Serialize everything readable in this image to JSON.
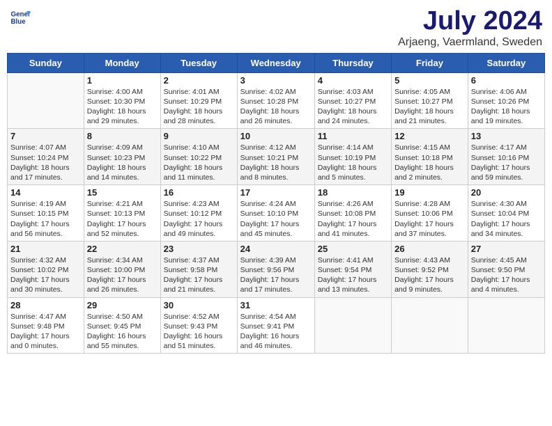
{
  "logo": {
    "line1": "General",
    "line2": "Blue"
  },
  "title": "July 2024",
  "location": "Arjaeng, Vaermland, Sweden",
  "weekdays": [
    "Sunday",
    "Monday",
    "Tuesday",
    "Wednesday",
    "Thursday",
    "Friday",
    "Saturday"
  ],
  "weeks": [
    [
      {
        "day": "",
        "info": ""
      },
      {
        "day": "1",
        "info": "Sunrise: 4:00 AM\nSunset: 10:30 PM\nDaylight: 18 hours\nand 29 minutes."
      },
      {
        "day": "2",
        "info": "Sunrise: 4:01 AM\nSunset: 10:29 PM\nDaylight: 18 hours\nand 28 minutes."
      },
      {
        "day": "3",
        "info": "Sunrise: 4:02 AM\nSunset: 10:28 PM\nDaylight: 18 hours\nand 26 minutes."
      },
      {
        "day": "4",
        "info": "Sunrise: 4:03 AM\nSunset: 10:27 PM\nDaylight: 18 hours\nand 24 minutes."
      },
      {
        "day": "5",
        "info": "Sunrise: 4:05 AM\nSunset: 10:27 PM\nDaylight: 18 hours\nand 21 minutes."
      },
      {
        "day": "6",
        "info": "Sunrise: 4:06 AM\nSunset: 10:26 PM\nDaylight: 18 hours\nand 19 minutes."
      }
    ],
    [
      {
        "day": "7",
        "info": "Sunrise: 4:07 AM\nSunset: 10:24 PM\nDaylight: 18 hours\nand 17 minutes."
      },
      {
        "day": "8",
        "info": "Sunrise: 4:09 AM\nSunset: 10:23 PM\nDaylight: 18 hours\nand 14 minutes."
      },
      {
        "day": "9",
        "info": "Sunrise: 4:10 AM\nSunset: 10:22 PM\nDaylight: 18 hours\nand 11 minutes."
      },
      {
        "day": "10",
        "info": "Sunrise: 4:12 AM\nSunset: 10:21 PM\nDaylight: 18 hours\nand 8 minutes."
      },
      {
        "day": "11",
        "info": "Sunrise: 4:14 AM\nSunset: 10:19 PM\nDaylight: 18 hours\nand 5 minutes."
      },
      {
        "day": "12",
        "info": "Sunrise: 4:15 AM\nSunset: 10:18 PM\nDaylight: 18 hours\nand 2 minutes."
      },
      {
        "day": "13",
        "info": "Sunrise: 4:17 AM\nSunset: 10:16 PM\nDaylight: 17 hours\nand 59 minutes."
      }
    ],
    [
      {
        "day": "14",
        "info": "Sunrise: 4:19 AM\nSunset: 10:15 PM\nDaylight: 17 hours\nand 56 minutes."
      },
      {
        "day": "15",
        "info": "Sunrise: 4:21 AM\nSunset: 10:13 PM\nDaylight: 17 hours\nand 52 minutes."
      },
      {
        "day": "16",
        "info": "Sunrise: 4:23 AM\nSunset: 10:12 PM\nDaylight: 17 hours\nand 49 minutes."
      },
      {
        "day": "17",
        "info": "Sunrise: 4:24 AM\nSunset: 10:10 PM\nDaylight: 17 hours\nand 45 minutes."
      },
      {
        "day": "18",
        "info": "Sunrise: 4:26 AM\nSunset: 10:08 PM\nDaylight: 17 hours\nand 41 minutes."
      },
      {
        "day": "19",
        "info": "Sunrise: 4:28 AM\nSunset: 10:06 PM\nDaylight: 17 hours\nand 37 minutes."
      },
      {
        "day": "20",
        "info": "Sunrise: 4:30 AM\nSunset: 10:04 PM\nDaylight: 17 hours\nand 34 minutes."
      }
    ],
    [
      {
        "day": "21",
        "info": "Sunrise: 4:32 AM\nSunset: 10:02 PM\nDaylight: 17 hours\nand 30 minutes."
      },
      {
        "day": "22",
        "info": "Sunrise: 4:34 AM\nSunset: 10:00 PM\nDaylight: 17 hours\nand 26 minutes."
      },
      {
        "day": "23",
        "info": "Sunrise: 4:37 AM\nSunset: 9:58 PM\nDaylight: 17 hours\nand 21 minutes."
      },
      {
        "day": "24",
        "info": "Sunrise: 4:39 AM\nSunset: 9:56 PM\nDaylight: 17 hours\nand 17 minutes."
      },
      {
        "day": "25",
        "info": "Sunrise: 4:41 AM\nSunset: 9:54 PM\nDaylight: 17 hours\nand 13 minutes."
      },
      {
        "day": "26",
        "info": "Sunrise: 4:43 AM\nSunset: 9:52 PM\nDaylight: 17 hours\nand 9 minutes."
      },
      {
        "day": "27",
        "info": "Sunrise: 4:45 AM\nSunset: 9:50 PM\nDaylight: 17 hours\nand 4 minutes."
      }
    ],
    [
      {
        "day": "28",
        "info": "Sunrise: 4:47 AM\nSunset: 9:48 PM\nDaylight: 17 hours\nand 0 minutes."
      },
      {
        "day": "29",
        "info": "Sunrise: 4:50 AM\nSunset: 9:45 PM\nDaylight: 16 hours\nand 55 minutes."
      },
      {
        "day": "30",
        "info": "Sunrise: 4:52 AM\nSunset: 9:43 PM\nDaylight: 16 hours\nand 51 minutes."
      },
      {
        "day": "31",
        "info": "Sunrise: 4:54 AM\nSunset: 9:41 PM\nDaylight: 16 hours\nand 46 minutes."
      },
      {
        "day": "",
        "info": ""
      },
      {
        "day": "",
        "info": ""
      },
      {
        "day": "",
        "info": ""
      }
    ]
  ]
}
